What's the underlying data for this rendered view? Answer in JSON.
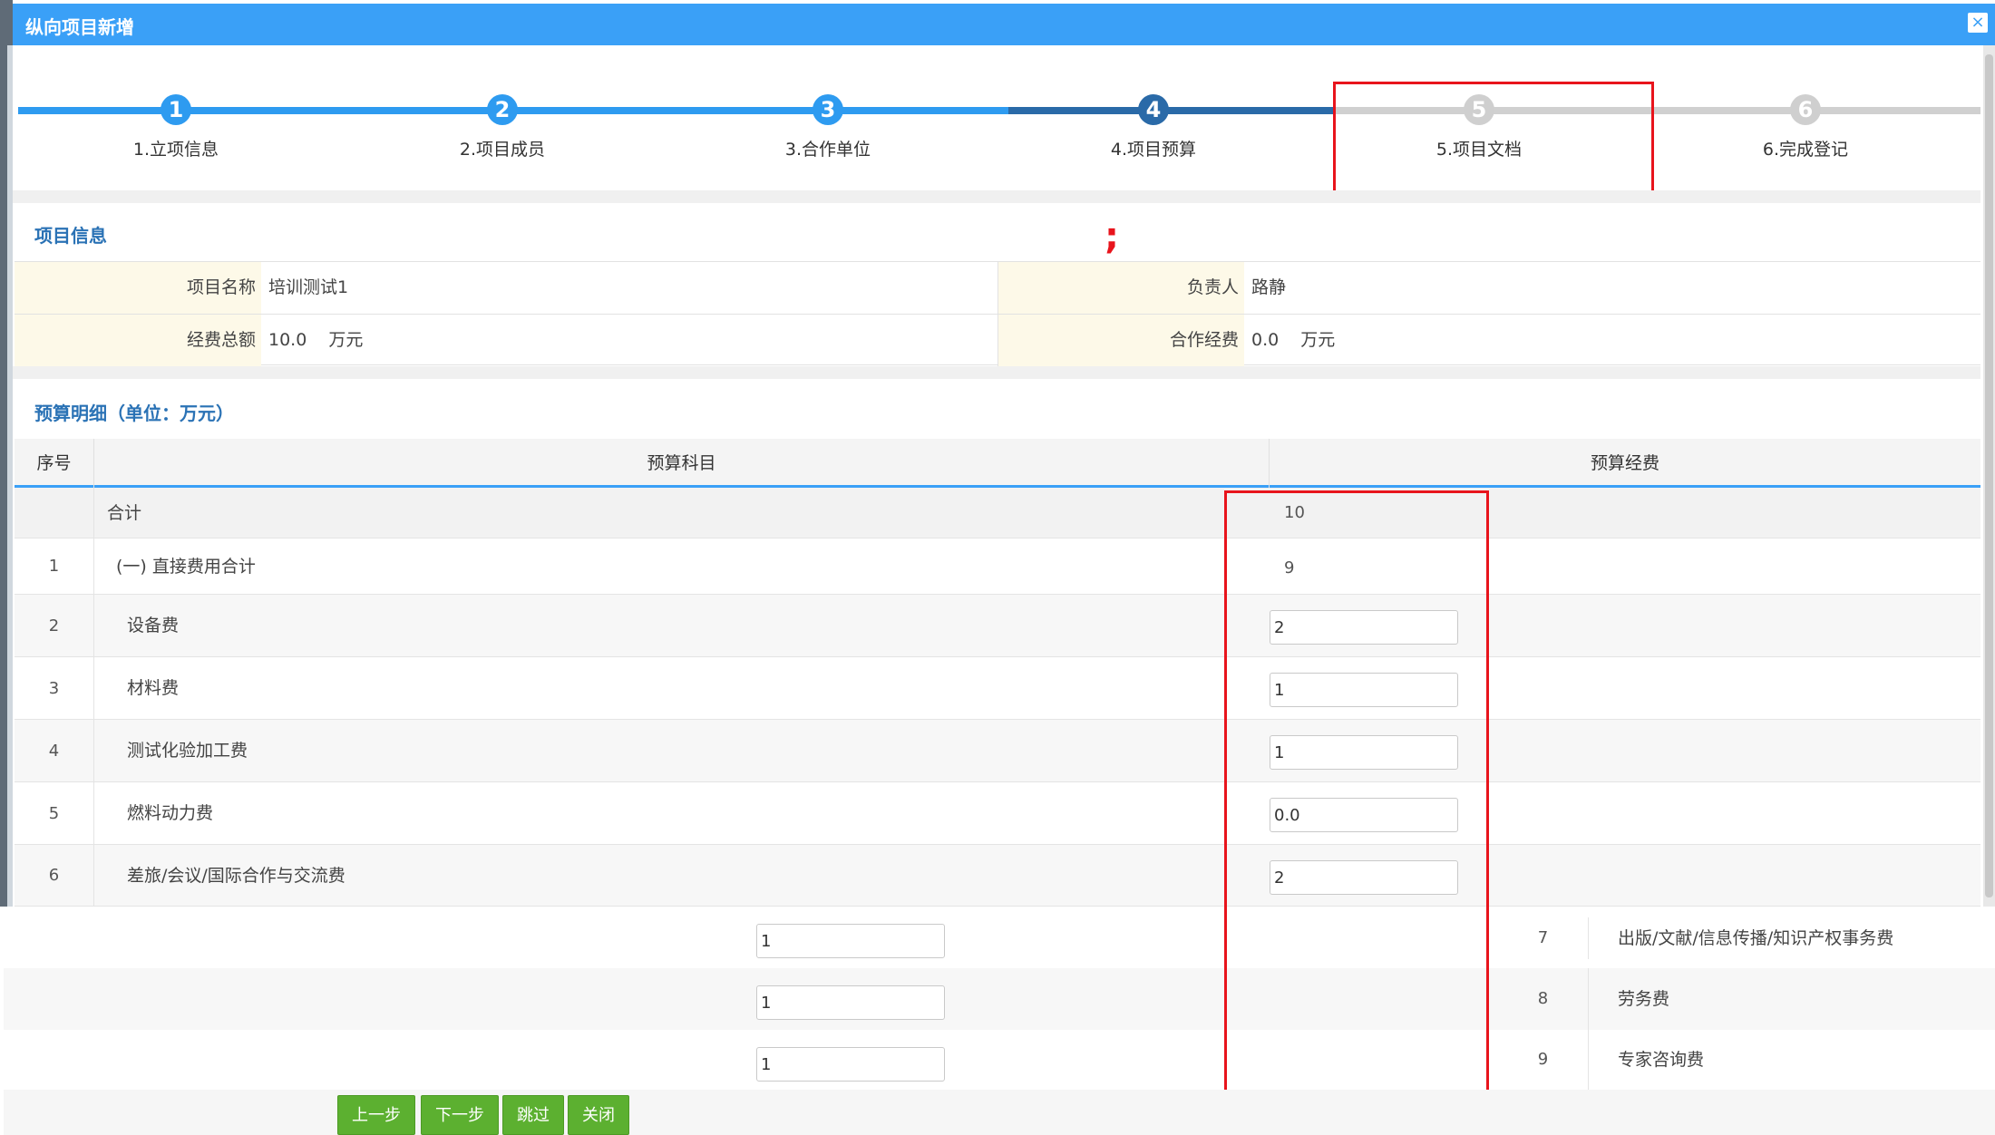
{
  "window": {
    "title": "纵向项目新增",
    "close_icon": "close-icon"
  },
  "wizard": {
    "steps": [
      {
        "number": "1",
        "label": "1.立项信息",
        "state": "done"
      },
      {
        "number": "2",
        "label": "2.项目成员",
        "state": "done"
      },
      {
        "number": "3",
        "label": "3.合作单位",
        "state": "done"
      },
      {
        "number": "4",
        "label": "4.项目预算",
        "state": "current"
      },
      {
        "number": "5",
        "label": "5.项目文档",
        "state": "todo"
      },
      {
        "number": "6",
        "label": "6.完成登记",
        "state": "todo"
      }
    ]
  },
  "annotation_mark": ";",
  "project_info": {
    "title": "项目信息",
    "name_label": "项目名称",
    "name_value": "培训测试1",
    "leader_label": "负责人",
    "leader_value": "路静",
    "total_label": "经费总额",
    "total_value": "10.0",
    "total_unit": "万元",
    "coop_label": "合作经费",
    "coop_value": "0.0",
    "coop_unit": "万元"
  },
  "budget": {
    "title": "预算明细（单位：万元）",
    "headers": {
      "seq": "序号",
      "subject": "预算科目",
      "amount": "预算经费"
    },
    "total_row": {
      "label": "合计",
      "value": "10"
    },
    "rows": [
      {
        "seq": "1",
        "subject": "(一) 直接费用合计",
        "value": "9"
      },
      {
        "seq": "2",
        "subject": "设备费",
        "input": "2"
      },
      {
        "seq": "3",
        "subject": "材料费",
        "input": "1"
      },
      {
        "seq": "4",
        "subject": "测试化验加工费",
        "input": "1"
      },
      {
        "seq": "5",
        "subject": "燃料动力费",
        "input": "0.0"
      },
      {
        "seq": "6",
        "subject": "差旅/会议/国际合作与交流费",
        "input": "2"
      }
    ],
    "lower_rows": [
      {
        "seq": "7",
        "subject": "出版/文献/信息传播/知识产权事务费",
        "input": "1"
      },
      {
        "seq": "8",
        "subject": "劳务费",
        "input": "1"
      },
      {
        "seq": "9",
        "subject": "专家咨询费",
        "input": "1"
      }
    ]
  },
  "buttons": {
    "prev": "上一步",
    "next": "下一步",
    "skip": "跳过",
    "close": "关闭"
  },
  "colors": {
    "accent": "#3aa0f7",
    "current_step": "#2a6aa8",
    "highlight": "#e8141c",
    "button": "#5cb030"
  }
}
